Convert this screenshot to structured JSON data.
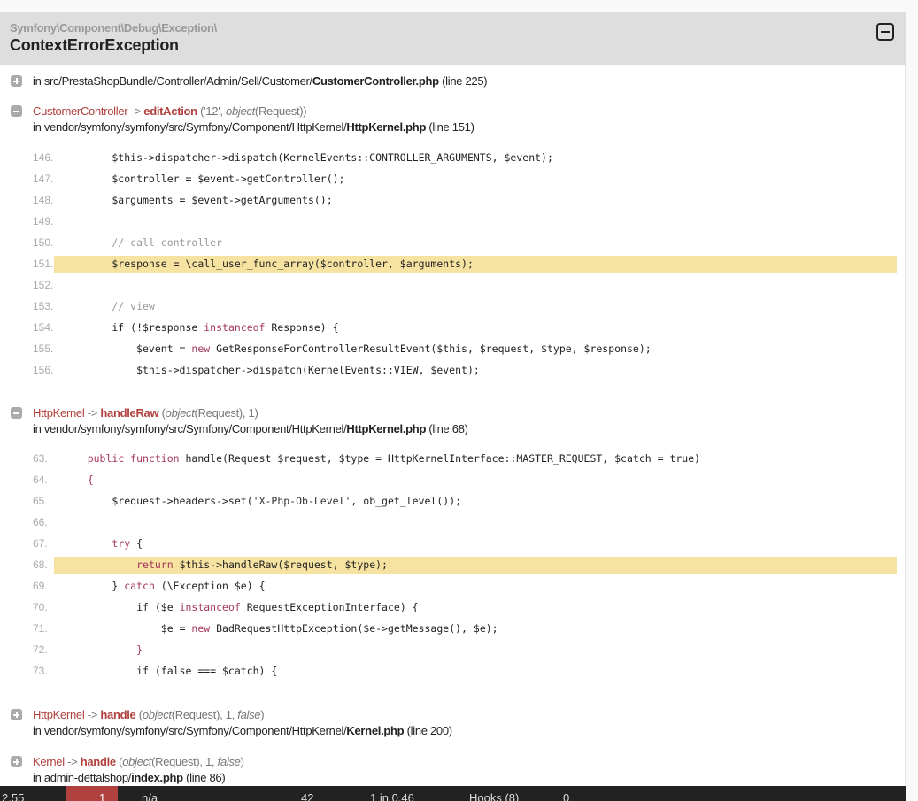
{
  "exception": {
    "namespace": "Symfony\\Component\\Debug\\Exception\\",
    "class": "ContextErrorException"
  },
  "traces": [
    {
      "expanded": false,
      "location_prefix": "in src/PrestaShopBundle/Controller/Admin/Sell/Customer/",
      "file": "CustomerController.php",
      "line": "(line 225)"
    },
    {
      "expanded": true,
      "class": "CustomerController",
      "arrow": " -> ",
      "method": "editAction",
      "args_pre": " ('12', ",
      "args_italic": "object",
      "args_post": "(Request))",
      "location_prefix": "in vendor/symfony/symfony/src/Symfony/Component/HttpKernel/",
      "file": "HttpKernel.php",
      "line": "(line 151)",
      "code": [
        {
          "n": "146.",
          "hl": false,
          "seg": [
            [
              "        $this->dispatcher->dispatch(KernelEvents::CONTROLLER_ARGUMENTS, $event);",
              ""
            ]
          ]
        },
        {
          "n": "147.",
          "hl": false,
          "seg": [
            [
              "        $controller = $event->getController();",
              ""
            ]
          ]
        },
        {
          "n": "148.",
          "hl": false,
          "seg": [
            [
              "        $arguments = $event->getArguments();",
              ""
            ]
          ]
        },
        {
          "n": "149.",
          "hl": false,
          "seg": []
        },
        {
          "n": "150.",
          "hl": false,
          "seg": [
            [
              "        // call controller",
              "cm"
            ]
          ]
        },
        {
          "n": "151.",
          "hl": true,
          "seg": [
            [
              "        $response = \\call_user_func_array($controller, $arguments);",
              ""
            ]
          ]
        },
        {
          "n": "152.",
          "hl": false,
          "seg": []
        },
        {
          "n": "153.",
          "hl": false,
          "seg": [
            [
              "        // view",
              "cm"
            ]
          ]
        },
        {
          "n": "154.",
          "hl": false,
          "seg": [
            [
              "        if (!$response ",
              ""
            ],
            [
              "instanceof",
              "kw"
            ],
            [
              " Response) {",
              ""
            ]
          ]
        },
        {
          "n": "155.",
          "hl": false,
          "seg": [
            [
              "            $event = ",
              ""
            ],
            [
              "new",
              "kw"
            ],
            [
              " GetResponseForControllerResultEvent($this, $request, $type, $response);",
              ""
            ]
          ]
        },
        {
          "n": "156.",
          "hl": false,
          "seg": [
            [
              "            $this->dispatcher->dispatch(KernelEvents::VIEW, $event);",
              ""
            ]
          ]
        }
      ]
    },
    {
      "expanded": true,
      "class": "HttpKernel",
      "arrow": " -> ",
      "method": "handleRaw",
      "args_pre": " (",
      "args_italic": "object",
      "args_post": "(Request), 1)",
      "location_prefix": "in vendor/symfony/symfony/src/Symfony/Component/HttpKernel/",
      "file": "HttpKernel.php",
      "line": "(line 68)",
      "code": [
        {
          "n": "63.",
          "hl": false,
          "seg": [
            [
              "    ",
              ""
            ],
            [
              "public function",
              "kw"
            ],
            [
              " handle(Request $request, $type = HttpKernelInterface::MASTER_REQUEST, $catch = true)",
              ""
            ]
          ]
        },
        {
          "n": "64.",
          "hl": false,
          "seg": [
            [
              "    {",
              "kw"
            ]
          ]
        },
        {
          "n": "65.",
          "hl": false,
          "seg": [
            [
              "        $request->headers->set(",
              ""
            ],
            [
              "'X-Php-Ob-Level'",
              "st"
            ],
            [
              ", ob_get_level());",
              ""
            ]
          ]
        },
        {
          "n": "66.",
          "hl": false,
          "seg": []
        },
        {
          "n": "67.",
          "hl": false,
          "seg": [
            [
              "        ",
              ""
            ],
            [
              "try",
              "kw"
            ],
            [
              " {",
              ""
            ]
          ]
        },
        {
          "n": "68.",
          "hl": true,
          "seg": [
            [
              "            ",
              ""
            ],
            [
              "return",
              "kw"
            ],
            [
              " $this->handleRaw($request, $type);",
              ""
            ]
          ]
        },
        {
          "n": "69.",
          "hl": false,
          "seg": [
            [
              "        } ",
              ""
            ],
            [
              "catch",
              "kw"
            ],
            [
              " (\\Exception $e) {",
              ""
            ]
          ]
        },
        {
          "n": "70.",
          "hl": false,
          "seg": [
            [
              "            if ($e ",
              ""
            ],
            [
              "instanceof",
              "kw"
            ],
            [
              " RequestExceptionInterface) {",
              ""
            ]
          ]
        },
        {
          "n": "71.",
          "hl": false,
          "seg": [
            [
              "                $e = ",
              ""
            ],
            [
              "new",
              "kw"
            ],
            [
              " BadRequestHttpException($e->getMessage(), $e);",
              ""
            ]
          ]
        },
        {
          "n": "72.",
          "hl": false,
          "seg": [
            [
              "            }",
              "kw"
            ]
          ]
        },
        {
          "n": "73.",
          "hl": false,
          "seg": [
            [
              "            if (false === $catch) {",
              ""
            ]
          ]
        }
      ]
    },
    {
      "expanded": false,
      "class": "HttpKernel",
      "arrow": " -> ",
      "method": "handle",
      "args_pre": " (",
      "args_italic": "object",
      "args_post": "(Request), 1, ",
      "args_italic2": "false",
      "args_end": ")",
      "location_prefix": "in vendor/symfony/symfony/src/Symfony/Component/HttpKernel/",
      "file": "Kernel.php",
      "line": "(line 200)"
    },
    {
      "expanded": false,
      "class": "Kernel",
      "arrow": " -> ",
      "method": "handle",
      "args_pre": " (",
      "args_italic": "object",
      "args_post": "(Request), 1, ",
      "args_italic2": "false",
      "args_end": ")",
      "location_prefix": "in admin-dettalshop/",
      "file": "index.php",
      "line": "(line 86)"
    }
  ],
  "toolbar": {
    "items": [
      "2.55",
      "1",
      "n/a",
      "42",
      "1 in 0.46",
      "Hooks (8)",
      "0"
    ]
  },
  "colors": {
    "accent": "#b0413e",
    "highlight": "#f7e3a1",
    "header": "#dedede"
  }
}
